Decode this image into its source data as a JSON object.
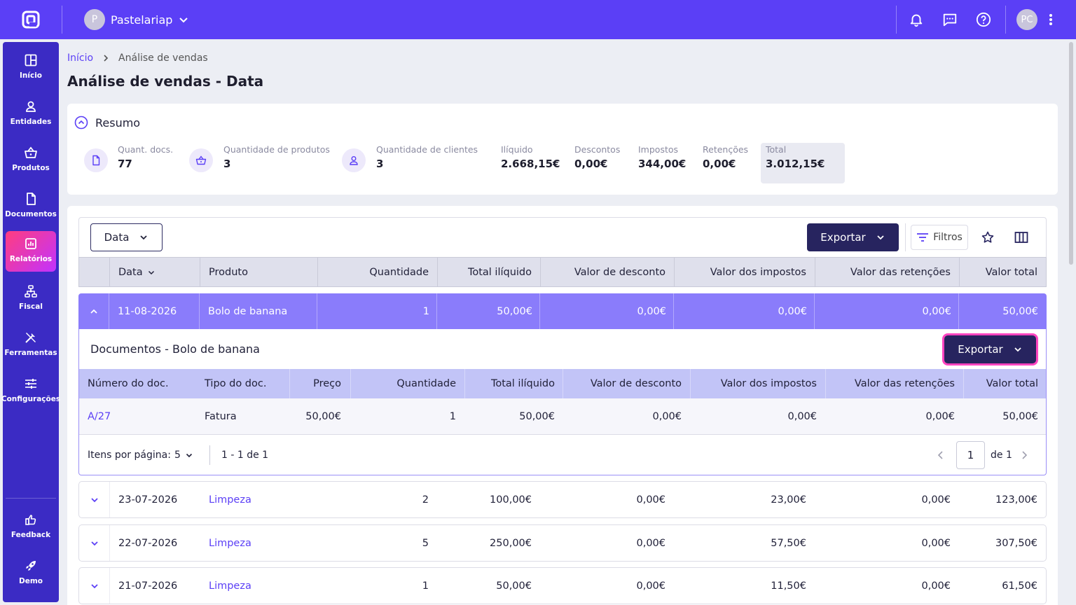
{
  "topbar": {
    "company_initial": "P",
    "company_name": "Pastelariap",
    "user_initials": "PC"
  },
  "sidebar": {
    "items": [
      {
        "label": "Início",
        "icon": "dashboard-icon"
      },
      {
        "label": "Entidades",
        "icon": "user-icon"
      },
      {
        "label": "Produtos",
        "icon": "basket-icon"
      },
      {
        "label": "Documentos",
        "icon": "document-icon"
      },
      {
        "label": "Relatórios",
        "icon": "chart-icon",
        "active": true
      },
      {
        "label": "Fiscal",
        "icon": "fiscal-icon"
      },
      {
        "label": "Ferramentas",
        "icon": "tools-icon"
      },
      {
        "label": "Configurações",
        "icon": "sliders-icon"
      }
    ],
    "bottom_items": [
      {
        "label": "Feedback",
        "icon": "feedback-icon"
      },
      {
        "label": "Demo",
        "icon": "rocket-icon"
      }
    ]
  },
  "breadcrumb": {
    "home": "Início",
    "current": "Análise de vendas"
  },
  "page_title": "Análise de vendas - Data",
  "summary": {
    "title": "Resumo",
    "docs": {
      "label": "Quant. docs.",
      "value": "77"
    },
    "products": {
      "label": "Quantidade de produtos",
      "value": "3"
    },
    "clients": {
      "label": "Quantidade de clientes",
      "value": "3"
    },
    "net": {
      "label": "Ilíquido",
      "value": "2.668,15€"
    },
    "discounts": {
      "label": "Descontos",
      "value": "0,00€"
    },
    "taxes": {
      "label": "Impostos",
      "value": "344,00€"
    },
    "withholdings": {
      "label": "Retenções",
      "value": "0,00€"
    },
    "total": {
      "label": "Total",
      "value": "3.012,15€"
    }
  },
  "toolbar": {
    "group_by": "Data",
    "export_label": "Exportar",
    "filters_label": "Filtros"
  },
  "table": {
    "headers": {
      "date": "Data",
      "product": "Produto",
      "quantity": "Quantidade",
      "net_total": "Total ilíquido",
      "discount": "Valor de desconto",
      "taxes": "Valor dos impostos",
      "withholdings": "Valor das retenções",
      "total": "Valor total"
    },
    "expanded_row": {
      "date": "11-08-2026",
      "product": "Bolo de banana",
      "quantity": "1",
      "net_total": "50,00€",
      "discount": "0,00€",
      "taxes": "0,00€",
      "withholdings": "0,00€",
      "total": "50,00€"
    },
    "rows": [
      {
        "date": "23-07-2026",
        "product": "Limpeza",
        "quantity": "2",
        "net_total": "100,00€",
        "discount": "0,00€",
        "taxes": "23,00€",
        "withholdings": "0,00€",
        "total": "123,00€"
      },
      {
        "date": "22-07-2026",
        "product": "Limpeza",
        "quantity": "5",
        "net_total": "250,00€",
        "discount": "0,00€",
        "taxes": "57,50€",
        "withholdings": "0,00€",
        "total": "307,50€"
      },
      {
        "date": "21-07-2026",
        "product": "Limpeza",
        "quantity": "1",
        "net_total": "50,00€",
        "discount": "0,00€",
        "taxes": "11,50€",
        "withholdings": "0,00€",
        "total": "61,50€"
      }
    ]
  },
  "detail": {
    "title": "Documentos - Bolo de banana",
    "export_label": "Exportar",
    "headers": {
      "doc_number": "Número do doc.",
      "doc_type": "Tipo do doc.",
      "price": "Preço",
      "quantity": "Quantidade",
      "net_total": "Total ilíquido",
      "discount": "Valor de desconto",
      "taxes": "Valor dos impostos",
      "withholdings": "Valor das retenções",
      "total": "Valor total"
    },
    "row": {
      "doc_number": "A/27",
      "doc_type": "Fatura",
      "price": "50,00€",
      "quantity": "1",
      "net_total": "50,00€",
      "discount": "0,00€",
      "taxes": "0,00€",
      "withholdings": "0,00€",
      "total": "50,00€"
    },
    "pagination": {
      "items_per_page_label": "Itens por página:",
      "items_per_page": "5",
      "range": "1 - 1 de 1",
      "page": "1",
      "of_pages": "de 1"
    }
  },
  "colors": {
    "topbar": "#5b3ff6",
    "sidebar": "#3b2bc4",
    "selected_row": "#8a7cfb",
    "primary_button": "#27245f",
    "highlight_ring": "#ff45c0"
  }
}
